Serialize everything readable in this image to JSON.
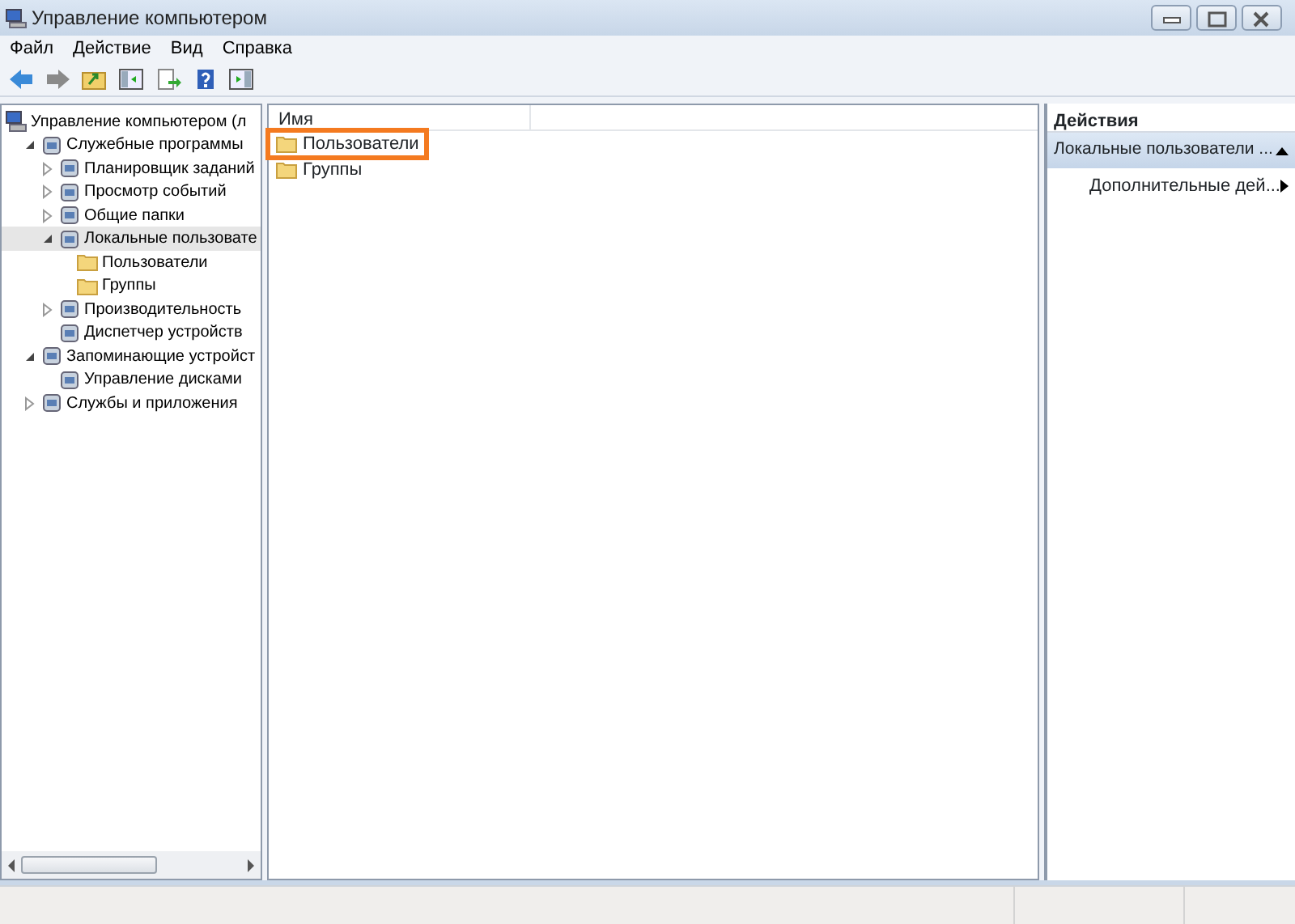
{
  "window": {
    "title": "Управление компьютером"
  },
  "menu": [
    "Файл",
    "Действие",
    "Вид",
    "Справка"
  ],
  "tree": [
    {
      "label": "Управление компьютером (л",
      "kind": "computer",
      "selected": false,
      "children": [
        {
          "label": "Служебные программы",
          "kind": "tool",
          "expanded": true,
          "selected": false,
          "children": [
            {
              "label": "Планировщик заданий",
              "kind": "tool",
              "expanded": false,
              "selected": false
            },
            {
              "label": "Просмотр событий",
              "kind": "tool",
              "expanded": false,
              "selected": false
            },
            {
              "label": "Общие папки",
              "kind": "tool",
              "expanded": false,
              "selected": false
            },
            {
              "label": "Локальные пользовате",
              "kind": "tool",
              "expanded": true,
              "selected": true,
              "children": [
                {
                  "label": "Пользователи",
                  "kind": "folder",
                  "selected": false
                },
                {
                  "label": "Группы",
                  "kind": "folder",
                  "selected": false
                }
              ]
            },
            {
              "label": "Производительность",
              "kind": "tool",
              "expanded": false,
              "selected": false
            },
            {
              "label": "Диспетчер устройств",
              "kind": "tool",
              "selected": false
            }
          ]
        },
        {
          "label": "Запоминающие устройст",
          "kind": "tool",
          "expanded": true,
          "selected": false,
          "children": [
            {
              "label": "Управление дисками",
              "kind": "tool",
              "selected": false
            }
          ]
        },
        {
          "label": "Службы и приложения",
          "kind": "tool",
          "expanded": false,
          "selected": false
        }
      ]
    }
  ],
  "list": {
    "columns": [
      "Имя"
    ],
    "rows": [
      {
        "name": "Пользователи",
        "highlighted": true
      },
      {
        "name": "Группы",
        "highlighted": false
      }
    ]
  },
  "actions": {
    "title": "Действия",
    "sections": [
      {
        "title": "Локальные пользователи ...",
        "expanded": true,
        "items": [
          "Дополнительные дей..."
        ]
      }
    ]
  }
}
